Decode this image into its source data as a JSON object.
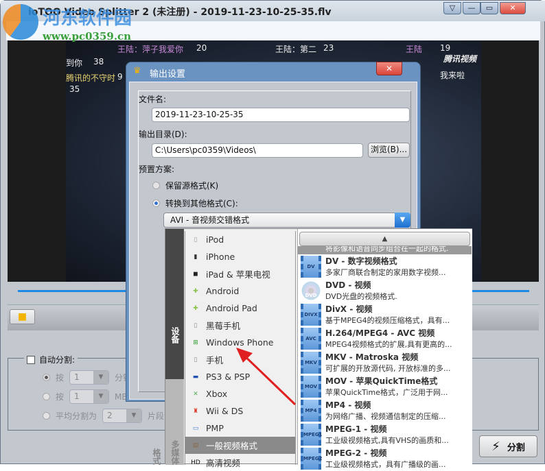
{
  "window": {
    "title": "ioTOO Video Splitter 2 (未注册)  - 2019-11-23-10-25-35.flv",
    "menu_icon": "▽",
    "minimize": "—",
    "maximize": "▭",
    "close": "✕"
  },
  "watermark": {
    "site_name": "河东软件园",
    "url": "www.pc0359.cn"
  },
  "video_overlay": [
    "王陆：萍子我爱你",
    "20",
    "王陆：第二",
    "23",
    "王陆",
    "19",
    "到你",
    "38",
    "腾讯的不守时",
    "9",
    "35",
    "我来啦",
    "腾讯视频"
  ],
  "toolbar": {
    "open_icon": "folder-icon"
  },
  "auto_split": {
    "label": "自动分割:",
    "checked": false,
    "options": [
      {
        "prefix": "按",
        "value": "1",
        "suffix": "分钟",
        "selected": true
      },
      {
        "prefix": "按",
        "value": "1",
        "suffix": "MB",
        "selected": false
      },
      {
        "prefix": "平均分割为",
        "value": "2",
        "suffix": "片段",
        "selected": false
      }
    ]
  },
  "split_button": {
    "label": "分割"
  },
  "dialog": {
    "title": "输出设置",
    "close": "✕",
    "filename_label": "文件名:",
    "filename_value": "2019-11-23-10-25-35",
    "outdir_label": "输出目录(D):",
    "outdir_value": "C:\\Users\\pc0359\\Videos\\",
    "browse": "浏览(B)...",
    "preset_label": "预置方案:",
    "keep_format": "保留源格式(K)",
    "convert_format": "转换到其他格式(C):",
    "selected_format": "AVI - 音视频交错格式"
  },
  "dropdown": {
    "tabs": [
      "设备",
      "多媒体格式"
    ],
    "categories": [
      "iPod",
      "iPhone",
      "iPad & 苹果电视",
      "Android",
      "Android Pad",
      "黑莓手机",
      "Windows Phone",
      "手机",
      "PS3 & PSP",
      "Xbox",
      "Wii & DS",
      "PMP",
      "一般视频格式",
      "高清视频"
    ],
    "selected_category": "一般视频格式",
    "partial_desc": "将影像和语音同步组合在一起的格式.",
    "formats": [
      {
        "icon": "DV",
        "title": "DV - 数字视频格式",
        "desc": "多家厂商联合制定的家用数字视频..."
      },
      {
        "icon": "DVD",
        "title": "DVD - 视频",
        "desc": "DVD光盘的视频格式."
      },
      {
        "icon": "DIVX",
        "title": "DivX - 视频",
        "desc": "基于MPEG4的视频压缩格式，具有..."
      },
      {
        "icon": "AVC",
        "title": "H.264/MPEG4 - AVC 视频",
        "desc": "MPEG4视频格式的扩展,具有更高的..."
      },
      {
        "icon": "MKV",
        "title": "MKV - Matroska 视频",
        "desc": "可扩展的开放源代码, 开放标准的多..."
      },
      {
        "icon": "MOV",
        "title": "MOV - 苹果QuickTime格式",
        "desc": "苹果QuickTime格式，广泛用于网..."
      },
      {
        "icon": "MP4",
        "title": "MP4 - 视频",
        "desc": "为网络广播、视频通信制定的压缩..."
      },
      {
        "icon": "MPEG1",
        "title": "MPEG-1 - 视频",
        "desc": "工业级视频格式,具有VHS的画质和..."
      },
      {
        "icon": "MPEG2",
        "title": "MPEG-2 - 视频",
        "desc": "工业级视频格式，具有广播级的画..."
      }
    ]
  },
  "colors": {
    "dialog_title": "#6a93c2",
    "accent": "#1e88e5",
    "close": "#d9453a",
    "annotation_arrow": "#e02020"
  }
}
